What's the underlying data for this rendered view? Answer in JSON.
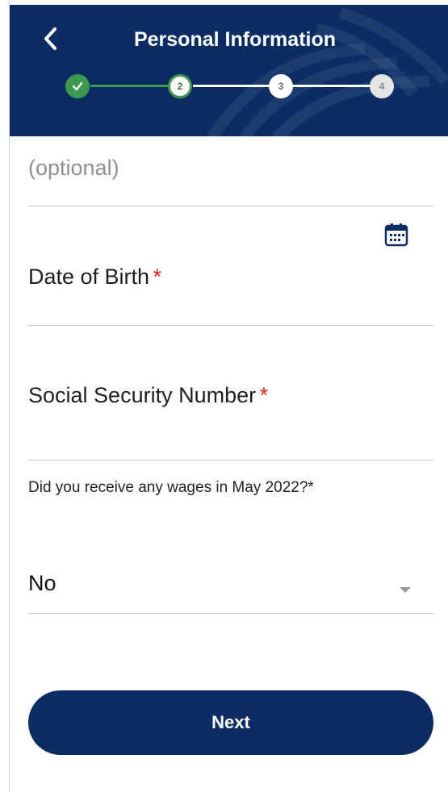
{
  "header": {
    "title": "Personal Information",
    "back_icon": "chevron-left-icon",
    "background_color": "#0b2d63",
    "accent_color": "#3c9a4f"
  },
  "stepper": {
    "current_step": 2,
    "steps": [
      {
        "label": "",
        "status": "completed",
        "icon": "check-icon"
      },
      {
        "label": "2",
        "status": "current"
      },
      {
        "label": "3",
        "status": "upcoming"
      },
      {
        "label": "4",
        "status": "upcoming"
      }
    ]
  },
  "form": {
    "optional_field": {
      "placeholder": "(optional)"
    },
    "date_of_birth": {
      "label": "Date of Birth",
      "required_mark": "*",
      "icon": "calendar-icon"
    },
    "ssn": {
      "label": "Social Security Number",
      "required_mark": "*"
    },
    "wages_question": {
      "label": "Did you receive any wages in May 2022?",
      "required_mark": "*",
      "selected_value": "No",
      "icon": "caret-down-icon"
    }
  },
  "actions": {
    "next_label": "Next"
  }
}
